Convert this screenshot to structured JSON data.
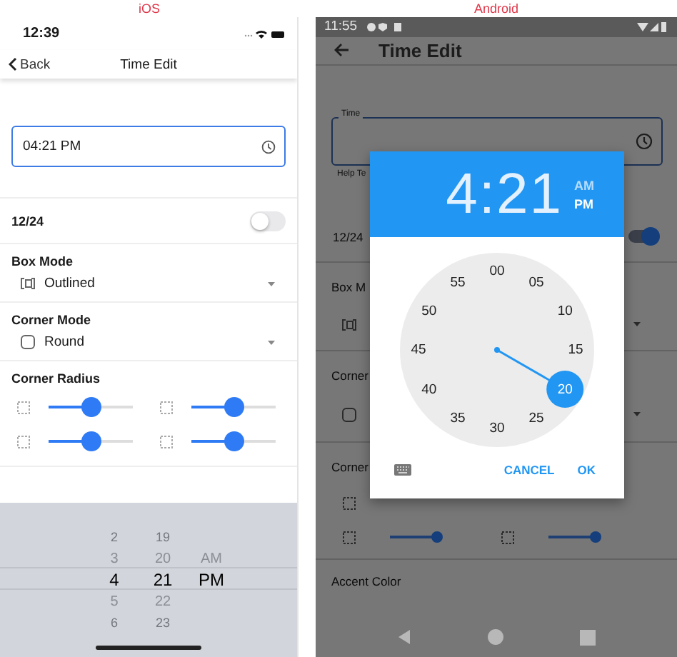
{
  "labels": {
    "ios": "iOS",
    "android": "Android"
  },
  "ios": {
    "status_bar": {
      "time": "12:39"
    },
    "nav": {
      "back": "Back",
      "title": "Time Edit"
    },
    "time_field": {
      "value": "04:21 PM"
    },
    "toggle": {
      "label": "12/24",
      "on": false
    },
    "dropdowns": [
      {
        "label": "Box Mode",
        "value": "Outlined",
        "kind": "outlined"
      },
      {
        "label": "Corner Mode",
        "value": "Round",
        "kind": "round"
      }
    ],
    "corner_radius": {
      "label": "Corner Radius",
      "sliders": [
        {
          "level": 0.5
        },
        {
          "level": 0.5
        },
        {
          "level": 0.5
        },
        {
          "level": 0.5
        }
      ]
    },
    "picker": {
      "columns": [
        {
          "items": [
            {
              "label": "2",
              "selected": false
            },
            {
              "label": "3",
              "selected": false
            },
            {
              "label": "4",
              "selected": true
            },
            {
              "label": "5",
              "selected": false
            },
            {
              "label": "6",
              "selected": false
            }
          ]
        },
        {
          "items": [
            {
              "label": "19",
              "selected": false
            },
            {
              "label": "20",
              "selected": false
            },
            {
              "label": "21",
              "selected": true
            },
            {
              "label": "22",
              "selected": false
            },
            {
              "label": "23",
              "selected": false
            }
          ]
        },
        {
          "items": [
            {
              "label": "AM",
              "selected": false
            },
            {
              "label": "PM",
              "selected": true
            }
          ]
        }
      ]
    }
  },
  "android": {
    "status_bar": {
      "time": "11:55"
    },
    "app_bar": {
      "title": "Time Edit"
    },
    "time_field": {
      "label": "Time",
      "help": "Help Te"
    },
    "toggle": {
      "label": "12/24",
      "on": true
    },
    "sections": [
      {
        "label": "Box M",
        "kind": "outlined"
      },
      {
        "label": "Corner",
        "kind": "round"
      }
    ],
    "corner_radius": {
      "label": "Corner",
      "sliders": [
        {
          "level": 1
        },
        {
          "level": 1
        }
      ]
    },
    "accent_label": "Accent Color",
    "dialog": {
      "time": "4:21",
      "periods": [
        {
          "label": "AM",
          "selected": false
        },
        {
          "label": "PM",
          "selected": true
        }
      ],
      "dial": [
        {
          "label": "00",
          "selected": false
        },
        {
          "label": "05",
          "selected": false
        },
        {
          "label": "10",
          "selected": false
        },
        {
          "label": "15",
          "selected": false
        },
        {
          "label": "20",
          "selected": true
        },
        {
          "label": "25",
          "selected": false
        },
        {
          "label": "30",
          "selected": false
        },
        {
          "label": "35",
          "selected": false
        },
        {
          "label": "40",
          "selected": false
        },
        {
          "label": "45",
          "selected": false
        },
        {
          "label": "50",
          "selected": false
        },
        {
          "label": "55",
          "selected": false
        }
      ],
      "buttons": [
        "CANCEL",
        "OK"
      ]
    }
  }
}
